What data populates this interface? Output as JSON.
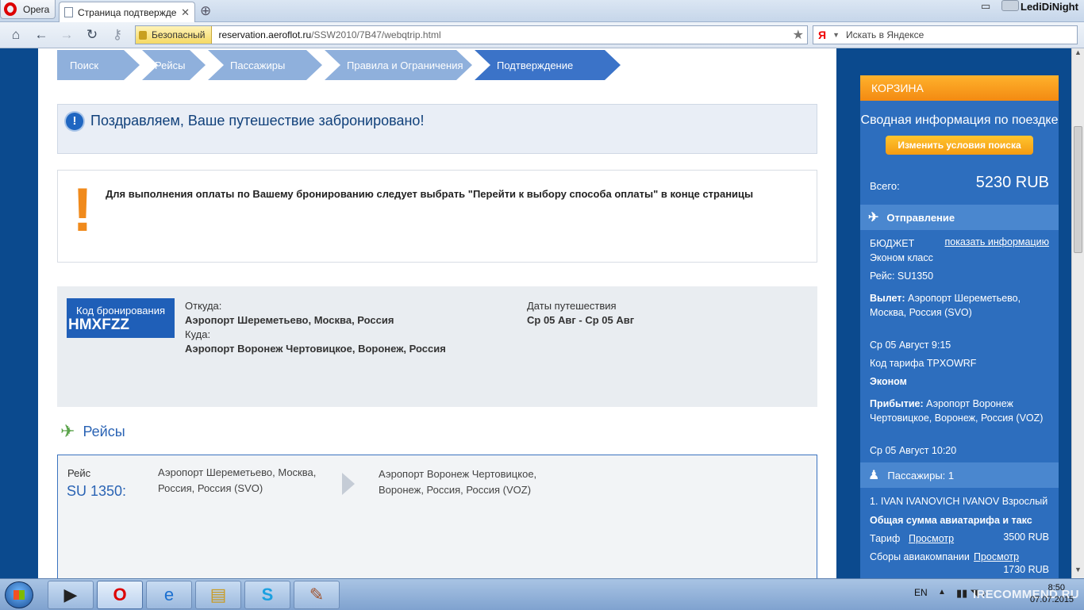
{
  "browser": {
    "menu_label": "Opera",
    "tab_title": "Страница подтвержде...",
    "user_name": "LediDiNight",
    "secure_label": "Безопасный",
    "url_host": "reservation.aeroflot.ru",
    "url_path": "/SSW2010/7B47/webqtrip.html",
    "search_placeholder": "Искать в Яндексе",
    "search_logo": "Я"
  },
  "steps": [
    "Поиск",
    "Рейсы",
    "Пассажиры",
    "Правила и Ограничения",
    "Подтверждение"
  ],
  "congrats": "Поздравляем, Ваше путешествие забронировано!",
  "notice": "Для выполнения оплаты по Вашему бронированию следует выбрать \"Перейти к выбору способа оплаты\" в конце страницы",
  "booking": {
    "code_label": "Код бронирования",
    "code": "HMXFZZ",
    "from_label": "Откуда:",
    "from": "Аэропорт Шереметьево, Москва, Россия",
    "to_label": "Куда:",
    "to": "Аэропорт Воронеж Чертовицкое, Воронеж, Россия",
    "dates_label": "Даты путешествия",
    "dates": "Ср 05 Авг - Ср 05 Авг"
  },
  "flights": {
    "title": "Рейсы",
    "flight_label": "Рейс",
    "flight_number": "SU 1350:",
    "origin": "Аэропорт Шереметьево, Москва, Россия, Россия (SVO)",
    "destination": "Аэропорт Воронеж Чертовицкое, Воронеж, Россия, Россия (VOZ)"
  },
  "cart": {
    "title": "КОРЗИНА",
    "subtitle": "Сводная информация по поездке",
    "change_button": "Изменить условия поиска",
    "total_label": "Всего:",
    "total_value": "5230 RUB",
    "departure_header": "Отправление",
    "fare_family": "БЮДЖЕТ",
    "show_info": "показать информацию",
    "cabin": "Эконом класс",
    "flight": "Рейс: SU1350",
    "dep_label": "Вылет:",
    "dep_airport": "Аэропорт Шереметьево, Москва, Россия (SVO)",
    "dep_time": "Ср 05 Август 9:15",
    "fare_code": "Код тарифа TPXOWRF",
    "fare_class": "Эконом",
    "arr_label": "Прибытие:",
    "arr_airport": "Аэропорт Воронеж Чертовицкое, Воронеж, Россия (VOZ)",
    "arr_time": "Ср 05 Август 10:20",
    "passengers_header": "Пассажиры: 1",
    "passenger": "1. IVAN IVANOVICH IVANOV Взрослый",
    "sum_title": "Общая сумма авиатарифа и такс",
    "tariff_label": "Тариф",
    "view_link": "Просмотр",
    "tariff_value": "3500 RUB",
    "fees_label": "Сборы авиакомпании",
    "fees_value": "1730 RUB"
  },
  "taskbar": {
    "lang": "EN",
    "time": "8:50",
    "date": "07.07.2015",
    "watermark": "IRECOMMEND.RU"
  },
  "colors": {
    "site_blue": "#0b4a8e",
    "step_active": "#3b73c8",
    "cart_blue": "#2d6ebe",
    "cart_orange": "#f38a12",
    "notice_orange": "#f08a1c"
  }
}
